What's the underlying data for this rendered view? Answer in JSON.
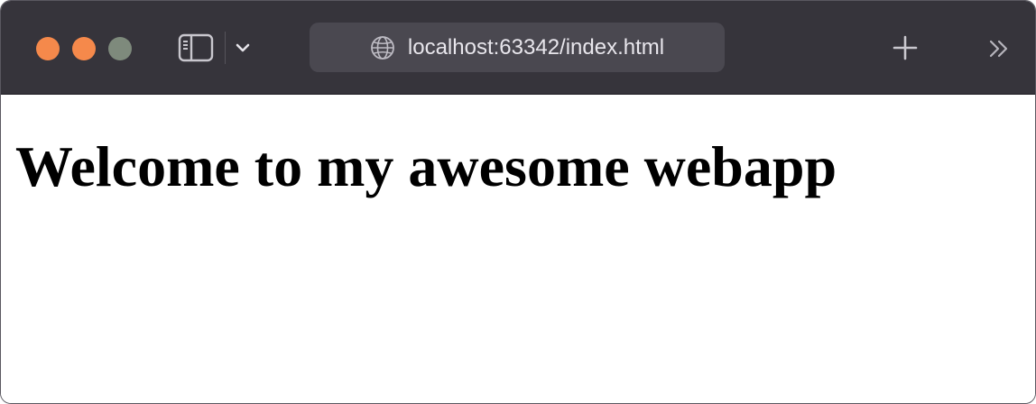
{
  "window": {
    "traffic_lights": {
      "close_color": "#f5894b",
      "minimize_color": "#f5894b",
      "maximize_color": "#7e8a7c"
    }
  },
  "toolbar": {
    "sidebar_icon": "sidebar-icon",
    "tab_chevron_icon": "chevron-down-icon",
    "new_tab_icon": "plus-icon",
    "overflow_icon": "double-chevron-right-icon"
  },
  "address_bar": {
    "icon": "globe-icon",
    "url": "localhost:63342/index.html"
  },
  "page": {
    "heading": "Welcome to my awesome webapp"
  }
}
